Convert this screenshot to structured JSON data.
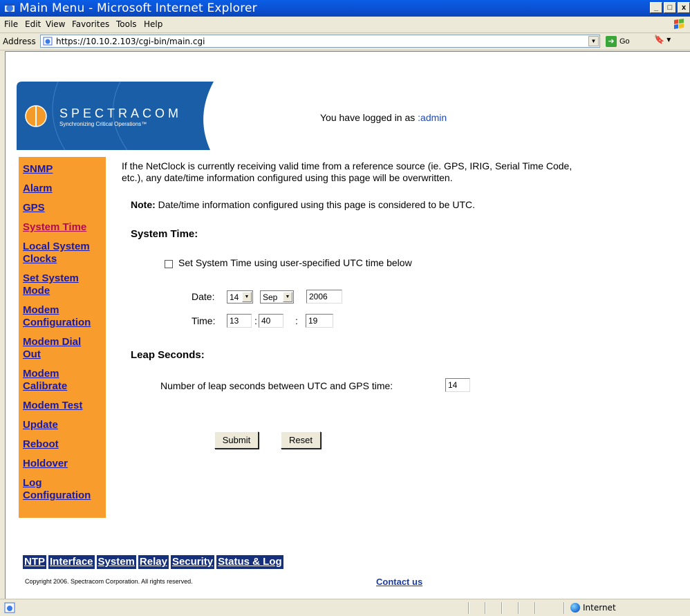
{
  "window": {
    "title": "Main Menu - Microsoft Internet Explorer",
    "min": "_",
    "max": "□",
    "close": "x"
  },
  "menu": {
    "file": "File",
    "edit": "Edit",
    "view": "View",
    "favorites": "Favorites",
    "tools": "Tools",
    "help": "Help"
  },
  "address": {
    "label": "Address",
    "url": "https://10.10.2.103/cgi-bin/main.cgi",
    "go": "Go"
  },
  "header": {
    "logo_text": "SPECTRACOM",
    "logo_tagline": "Synchronizing Critical Operations™",
    "logged_prefix": "You have logged in as ",
    "logged_user": ":admin"
  },
  "leftnav": [
    {
      "label": "SNMP"
    },
    {
      "label": "Alarm"
    },
    {
      "label": "GPS"
    },
    {
      "label": "System Time"
    },
    {
      "label": "Local System"
    },
    {
      "label": "Clocks"
    },
    {
      "label": "Set System"
    },
    {
      "label": "Mode"
    },
    {
      "label": "Modem"
    },
    {
      "label": "Configuration"
    },
    {
      "label": "Modem Dial"
    },
    {
      "label": "Out"
    },
    {
      "label": "Modem"
    },
    {
      "label": "Calibrate"
    },
    {
      "label": "Modem Test"
    },
    {
      "label": "Update"
    },
    {
      "label": "Reboot"
    },
    {
      "label": "Holdover"
    },
    {
      "label": "Log"
    },
    {
      "label": "Configuration"
    }
  ],
  "main": {
    "intro_line1": "If the NetClock is currently receiving valid time from a reference source (ie. GPS, IRIG, Serial Time Code,",
    "intro_line2": "etc.), any date/time information configured using this page will be overwritten.",
    "note_label": "Note:",
    "note_text": " Date/time information configured using this page is considered to be UTC.",
    "system_time_heading": "System Time:",
    "set_checkbox_label": "Set System Time using user-specified UTC time below",
    "date_label": "Date:",
    "date_day": "14",
    "date_month": "Sep",
    "date_year": "2006",
    "time_label": "Time:",
    "time_hour": "13",
    "time_min": "40",
    "time_sec": "19",
    "colon": ":",
    "leap_heading": "Leap Seconds:",
    "leap_label": "Number of leap seconds between UTC and GPS time:",
    "leap_value": "14",
    "submit": "Submit",
    "reset": "Reset"
  },
  "bottomnav": [
    "NTP",
    "Interface",
    "System",
    "Relay",
    "Security",
    "Status & Log"
  ],
  "footer": {
    "copyright": "Copyright 2006. Spectracom Corporation. All rights reserved.",
    "contact": "Contact us"
  },
  "status": {
    "zone": "Internet"
  }
}
